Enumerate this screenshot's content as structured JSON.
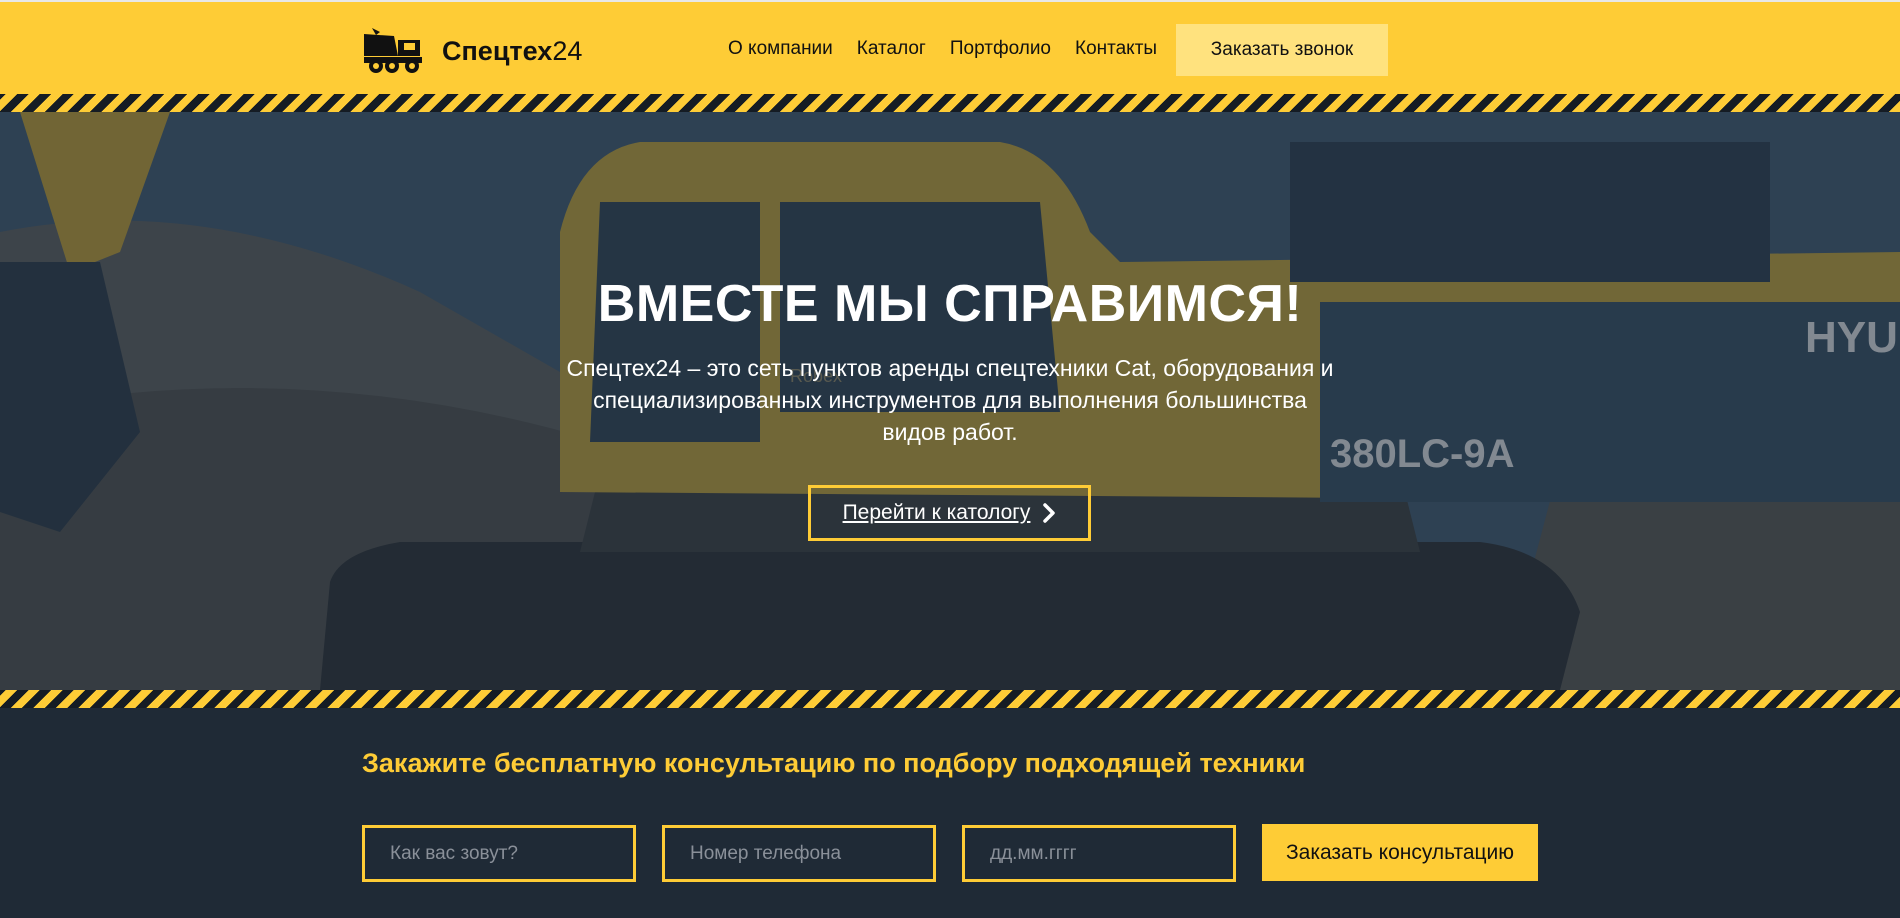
{
  "header": {
    "logo_bold": "Спецтех",
    "logo_regular": "24",
    "logo_icon": "dump-truck-icon",
    "nav": [
      "О компании",
      "Каталог",
      "Портфолио",
      "Контакты"
    ],
    "call_button": "Заказать звонок"
  },
  "hero": {
    "title": "ВМЕСТЕ МЫ СПРАВИМСЯ!",
    "subtitle": "Спецтех24 – это сеть пунктов аренды спецтехники Cat, оборудования и специализированных инструментов для выполнения большинства видов работ.",
    "button": "Перейти к катологу",
    "button_icon": "chevron-right-icon",
    "image_text": {
      "model": "380LC-9A",
      "brand": "HYUN",
      "cab": "Robex"
    }
  },
  "consult": {
    "title": "Закажите бесплатную консультацию по подбору подходящей техники",
    "name_placeholder": "Как вас зовут?",
    "phone_placeholder": "Номер телефона",
    "date_placeholder": "дд.мм.гггг",
    "button": "Заказать консультацию"
  },
  "colors": {
    "accent": "#fecc36",
    "dark": "#1f2a36",
    "call_button_bg": "#ffe27e"
  }
}
